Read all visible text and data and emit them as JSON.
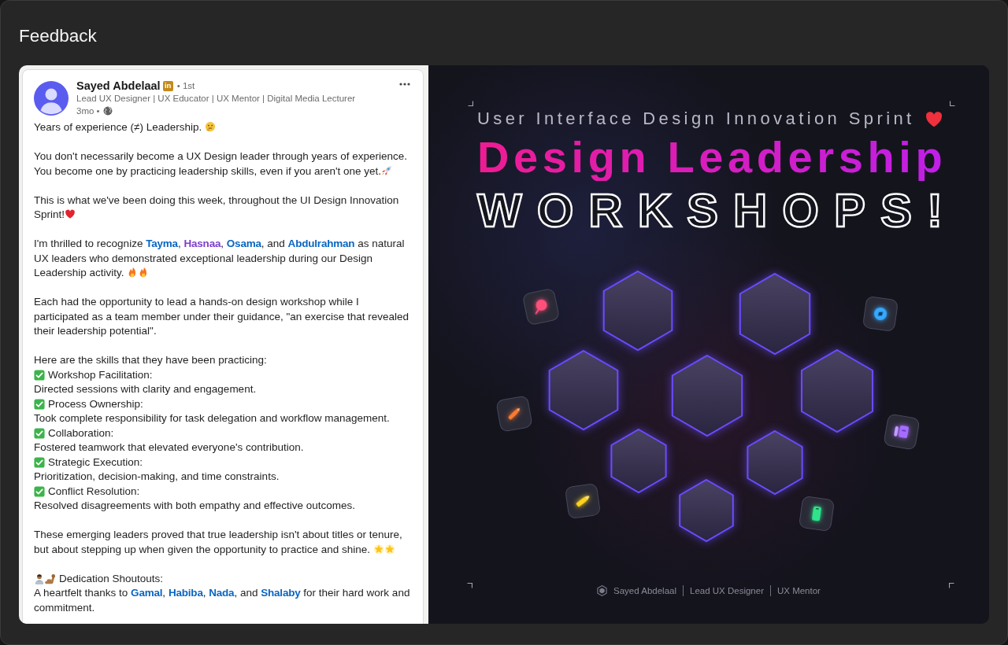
{
  "window": {
    "title": "Feedback"
  },
  "post": {
    "author": {
      "name": "Sayed Abdelaal",
      "badge": "in",
      "degree": "• 1st",
      "headline": "Lead UX Designer | UX Educator | UX Mentor | Digital Media Lecturer",
      "time": "3mo •"
    },
    "blocks": [
      {
        "kind": "text",
        "parts": [
          {
            "kind": "plain",
            "text": "Years of experience (≠) Leadership. "
          },
          {
            "kind": "emoji"
          }
        ]
      },
      {
        "kind": "text",
        "parts": [
          {
            "kind": "plain",
            "text": "You don't necessarily become a UX Design leader through years of experience. You become one by practicing leadership skills, even if you aren't one yet."
          },
          {
            "kind": "emoji"
          }
        ]
      },
      {
        "kind": "text",
        "parts": [
          {
            "kind": "plain",
            "text": "This is what we've been doing this week, throughout the UI Design Innovation Sprint!"
          },
          {
            "kind": "emoji"
          }
        ]
      },
      {
        "kind": "text",
        "parts": [
          {
            "kind": "plain",
            "text": "I'm thrilled to recognize "
          },
          {
            "kind": "mention",
            "text": "Tayma",
            "visited": false
          },
          {
            "kind": "plain",
            "text": ", "
          },
          {
            "kind": "mention",
            "text": "Hasnaa",
            "visited": true
          },
          {
            "kind": "plain",
            "text": ", "
          },
          {
            "kind": "mention",
            "text": "Osama",
            "visited": false
          },
          {
            "kind": "plain",
            "text": ", and "
          },
          {
            "kind": "mention",
            "text": "Abdulrahman",
            "visited": false
          },
          {
            "kind": "plain",
            "text": " as natural UX leaders who demonstrated exceptional leadership during our Design Leadership activity. "
          },
          {
            "kind": "emoji"
          },
          {
            "kind": "emoji"
          }
        ]
      },
      {
        "kind": "text",
        "parts": [
          {
            "kind": "plain",
            "text": "Each had the opportunity to lead a hands-on design workshop while I participated as a team member under their guidance, \"an exercise that revealed their leadership potential\"."
          }
        ]
      },
      {
        "kind": "list",
        "intro": "Here are the skills that they have been practicing:",
        "items": [
          {
            "title": "Workshop Facilitation:",
            "description": "Directed sessions with clarity and engagement."
          },
          {
            "title": "Process Ownership:",
            "description": "Took complete responsibility for task delegation and workflow management."
          },
          {
            "title": "Collaboration:",
            "description": "Fostered teamwork that elevated everyone's contribution."
          },
          {
            "title": "Strategic Execution:",
            "description": "Prioritization, decision-making, and time constraints."
          },
          {
            "title": "Conflict Resolution:",
            "description": "Resolved disagreements with both empathy and effective outcomes."
          }
        ]
      },
      {
        "kind": "text",
        "parts": [
          {
            "kind": "plain",
            "text": "These emerging leaders proved that true leadership isn't about titles or tenure, but about stepping up when given the opportunity to practice and shine. "
          },
          {
            "kind": "emoji"
          },
          {
            "kind": "emoji"
          }
        ]
      },
      {
        "kind": "shoutout",
        "title": "Dedication Shoutouts:",
        "parts": [
          {
            "kind": "plain",
            "text": "A heartfelt thanks to "
          },
          {
            "kind": "mention",
            "text": "Gamal",
            "visited": false
          },
          {
            "kind": "plain",
            "text": ", "
          },
          {
            "kind": "mention",
            "text": "Habiba",
            "visited": false
          },
          {
            "kind": "plain",
            "text": ", "
          },
          {
            "kind": "mention",
            "text": "Nada",
            "visited": false
          },
          {
            "kind": "plain",
            "text": ", and "
          },
          {
            "kind": "mention",
            "text": "Shalaby",
            "visited": false
          },
          {
            "kind": "plain",
            "text": " for their hard work and commitment."
          }
        ]
      }
    ]
  },
  "poster": {
    "kicker": "User Interface Design Innovation Sprint",
    "title": "Design Leadership",
    "subtitle": "WORKSHOPS!",
    "footer": [
      "Sayed Abdelaal",
      "Lead UX Designer",
      "UX Mentor"
    ]
  }
}
